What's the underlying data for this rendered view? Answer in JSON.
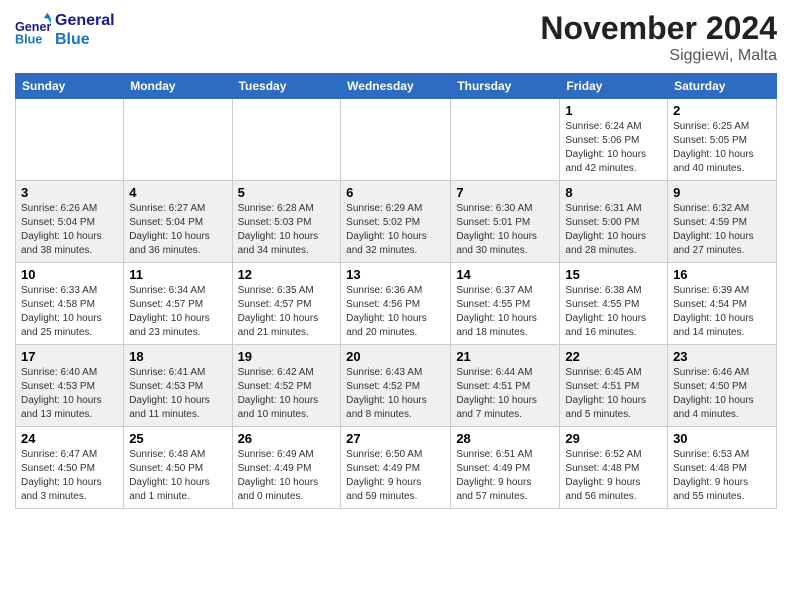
{
  "header": {
    "logo_general": "General",
    "logo_blue": "Blue",
    "month_title": "November 2024",
    "location": "Siggiewi, Malta"
  },
  "weekdays": [
    "Sunday",
    "Monday",
    "Tuesday",
    "Wednesday",
    "Thursday",
    "Friday",
    "Saturday"
  ],
  "weeks": [
    [
      {
        "day": "",
        "info": ""
      },
      {
        "day": "",
        "info": ""
      },
      {
        "day": "",
        "info": ""
      },
      {
        "day": "",
        "info": ""
      },
      {
        "day": "",
        "info": ""
      },
      {
        "day": "1",
        "info": "Sunrise: 6:24 AM\nSunset: 5:06 PM\nDaylight: 10 hours\nand 42 minutes."
      },
      {
        "day": "2",
        "info": "Sunrise: 6:25 AM\nSunset: 5:05 PM\nDaylight: 10 hours\nand 40 minutes."
      }
    ],
    [
      {
        "day": "3",
        "info": "Sunrise: 6:26 AM\nSunset: 5:04 PM\nDaylight: 10 hours\nand 38 minutes."
      },
      {
        "day": "4",
        "info": "Sunrise: 6:27 AM\nSunset: 5:04 PM\nDaylight: 10 hours\nand 36 minutes."
      },
      {
        "day": "5",
        "info": "Sunrise: 6:28 AM\nSunset: 5:03 PM\nDaylight: 10 hours\nand 34 minutes."
      },
      {
        "day": "6",
        "info": "Sunrise: 6:29 AM\nSunset: 5:02 PM\nDaylight: 10 hours\nand 32 minutes."
      },
      {
        "day": "7",
        "info": "Sunrise: 6:30 AM\nSunset: 5:01 PM\nDaylight: 10 hours\nand 30 minutes."
      },
      {
        "day": "8",
        "info": "Sunrise: 6:31 AM\nSunset: 5:00 PM\nDaylight: 10 hours\nand 28 minutes."
      },
      {
        "day": "9",
        "info": "Sunrise: 6:32 AM\nSunset: 4:59 PM\nDaylight: 10 hours\nand 27 minutes."
      }
    ],
    [
      {
        "day": "10",
        "info": "Sunrise: 6:33 AM\nSunset: 4:58 PM\nDaylight: 10 hours\nand 25 minutes."
      },
      {
        "day": "11",
        "info": "Sunrise: 6:34 AM\nSunset: 4:57 PM\nDaylight: 10 hours\nand 23 minutes."
      },
      {
        "day": "12",
        "info": "Sunrise: 6:35 AM\nSunset: 4:57 PM\nDaylight: 10 hours\nand 21 minutes."
      },
      {
        "day": "13",
        "info": "Sunrise: 6:36 AM\nSunset: 4:56 PM\nDaylight: 10 hours\nand 20 minutes."
      },
      {
        "day": "14",
        "info": "Sunrise: 6:37 AM\nSunset: 4:55 PM\nDaylight: 10 hours\nand 18 minutes."
      },
      {
        "day": "15",
        "info": "Sunrise: 6:38 AM\nSunset: 4:55 PM\nDaylight: 10 hours\nand 16 minutes."
      },
      {
        "day": "16",
        "info": "Sunrise: 6:39 AM\nSunset: 4:54 PM\nDaylight: 10 hours\nand 14 minutes."
      }
    ],
    [
      {
        "day": "17",
        "info": "Sunrise: 6:40 AM\nSunset: 4:53 PM\nDaylight: 10 hours\nand 13 minutes."
      },
      {
        "day": "18",
        "info": "Sunrise: 6:41 AM\nSunset: 4:53 PM\nDaylight: 10 hours\nand 11 minutes."
      },
      {
        "day": "19",
        "info": "Sunrise: 6:42 AM\nSunset: 4:52 PM\nDaylight: 10 hours\nand 10 minutes."
      },
      {
        "day": "20",
        "info": "Sunrise: 6:43 AM\nSunset: 4:52 PM\nDaylight: 10 hours\nand 8 minutes."
      },
      {
        "day": "21",
        "info": "Sunrise: 6:44 AM\nSunset: 4:51 PM\nDaylight: 10 hours\nand 7 minutes."
      },
      {
        "day": "22",
        "info": "Sunrise: 6:45 AM\nSunset: 4:51 PM\nDaylight: 10 hours\nand 5 minutes."
      },
      {
        "day": "23",
        "info": "Sunrise: 6:46 AM\nSunset: 4:50 PM\nDaylight: 10 hours\nand 4 minutes."
      }
    ],
    [
      {
        "day": "24",
        "info": "Sunrise: 6:47 AM\nSunset: 4:50 PM\nDaylight: 10 hours\nand 3 minutes."
      },
      {
        "day": "25",
        "info": "Sunrise: 6:48 AM\nSunset: 4:50 PM\nDaylight: 10 hours\nand 1 minute."
      },
      {
        "day": "26",
        "info": "Sunrise: 6:49 AM\nSunset: 4:49 PM\nDaylight: 10 hours\nand 0 minutes."
      },
      {
        "day": "27",
        "info": "Sunrise: 6:50 AM\nSunset: 4:49 PM\nDaylight: 9 hours\nand 59 minutes."
      },
      {
        "day": "28",
        "info": "Sunrise: 6:51 AM\nSunset: 4:49 PM\nDaylight: 9 hours\nand 57 minutes."
      },
      {
        "day": "29",
        "info": "Sunrise: 6:52 AM\nSunset: 4:48 PM\nDaylight: 9 hours\nand 56 minutes."
      },
      {
        "day": "30",
        "info": "Sunrise: 6:53 AM\nSunset: 4:48 PM\nDaylight: 9 hours\nand 55 minutes."
      }
    ]
  ]
}
